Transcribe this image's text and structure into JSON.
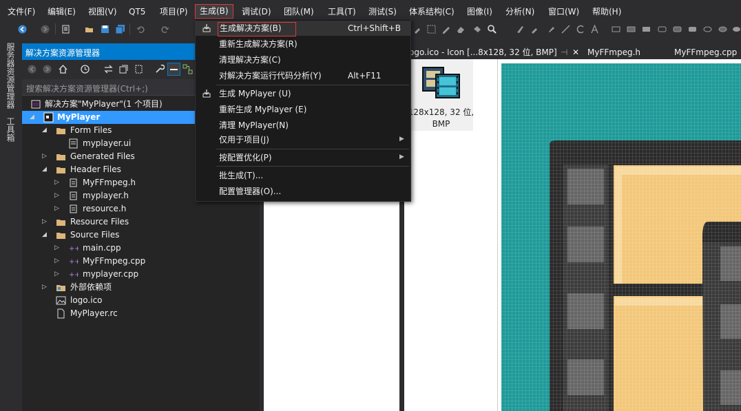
{
  "menubar": {
    "items": [
      {
        "label": "文件(F)"
      },
      {
        "label": "编辑(E)"
      },
      {
        "label": "视图(V)"
      },
      {
        "label": "QT5"
      },
      {
        "label": "项目(P)"
      },
      {
        "label": "生成(B)"
      },
      {
        "label": "调试(D)"
      },
      {
        "label": "团队(M)"
      },
      {
        "label": "工具(T)"
      },
      {
        "label": "测试(S)"
      },
      {
        "label": "体系结构(C)"
      },
      {
        "label": "图像(I)"
      },
      {
        "label": "分析(N)"
      },
      {
        "label": "窗口(W)"
      },
      {
        "label": "帮助(H)"
      }
    ]
  },
  "left_tabs": {
    "server_explorer": "服务器资源管理器",
    "toolbox": "工具箱"
  },
  "solution_explorer": {
    "title": "解决方案资源管理器",
    "search_placeholder": "搜索解决方案资源管理器(Ctrl+;)",
    "tree": [
      {
        "label": "解决方案\"MyPlayer\"(1 个项目)",
        "icon": "solution-icon"
      },
      {
        "label": "MyPlayer",
        "icon": "project-icon"
      },
      {
        "label": "Form Files",
        "icon": "folder-icon"
      },
      {
        "label": "myplayer.ui",
        "icon": "file-icon"
      },
      {
        "label": "Generated Files",
        "icon": "folder-icon"
      },
      {
        "label": "Header Files",
        "icon": "folder-icon"
      },
      {
        "label": "MyFFmpeg.h",
        "icon": "header-file-icon"
      },
      {
        "label": "myplayer.h",
        "icon": "header-file-icon"
      },
      {
        "label": "resource.h",
        "icon": "header-file-icon"
      },
      {
        "label": "Resource Files",
        "icon": "folder-icon"
      },
      {
        "label": "Source Files",
        "icon": "folder-icon"
      },
      {
        "label": "main.cpp",
        "icon": "cpp-file-icon"
      },
      {
        "label": "MyFFmpeg.cpp",
        "icon": "cpp-file-icon"
      },
      {
        "label": "myplayer.cpp",
        "icon": "cpp-file-icon"
      },
      {
        "label": "外部依赖项",
        "icon": "dependencies-icon"
      },
      {
        "label": "logo.ico",
        "icon": "image-file-icon"
      },
      {
        "label": "MyPlayer.rc",
        "icon": "resource-file-icon"
      }
    ]
  },
  "doc_tabs": {
    "active": "ogo.ico - Icon [...8x128, 32 位, BMP]",
    "pin": "⊣",
    "close": "✕",
    "tab2": "MyFFmpeg.h",
    "tab3": "MyFFmpeg.cpp"
  },
  "icon_list": {
    "caption_line1": "128x128, 32 位,",
    "caption_line2": "BMP"
  },
  "build_menu": {
    "items": [
      {
        "label": "生成解决方案(B)",
        "shortcut": "Ctrl+Shift+B"
      },
      {
        "label": "重新生成解决方案(R)",
        "shortcut": ""
      },
      {
        "label": "清理解决方案(C)",
        "shortcut": ""
      },
      {
        "label": "对解决方案运行代码分析(Y)",
        "shortcut": "Alt+F11"
      },
      {
        "label": "生成 MyPlayer (U)",
        "shortcut": ""
      },
      {
        "label": "重新生成 MyPlayer (E)",
        "shortcut": ""
      },
      {
        "label": "清理 MyPlayer(N)",
        "shortcut": ""
      },
      {
        "label": "仅用于项目(J)",
        "shortcut": ""
      },
      {
        "label": "按配置优化(P)",
        "shortcut": ""
      },
      {
        "label": "批生成(T)...",
        "shortcut": ""
      },
      {
        "label": "配置管理器(O)...",
        "shortcut": ""
      }
    ]
  },
  "colors": {
    "accent": "#007acc",
    "selection": "#3399ff",
    "highlight_border": "#e0393e",
    "teal": "#1e9a99",
    "sand": "#f3c77a"
  }
}
